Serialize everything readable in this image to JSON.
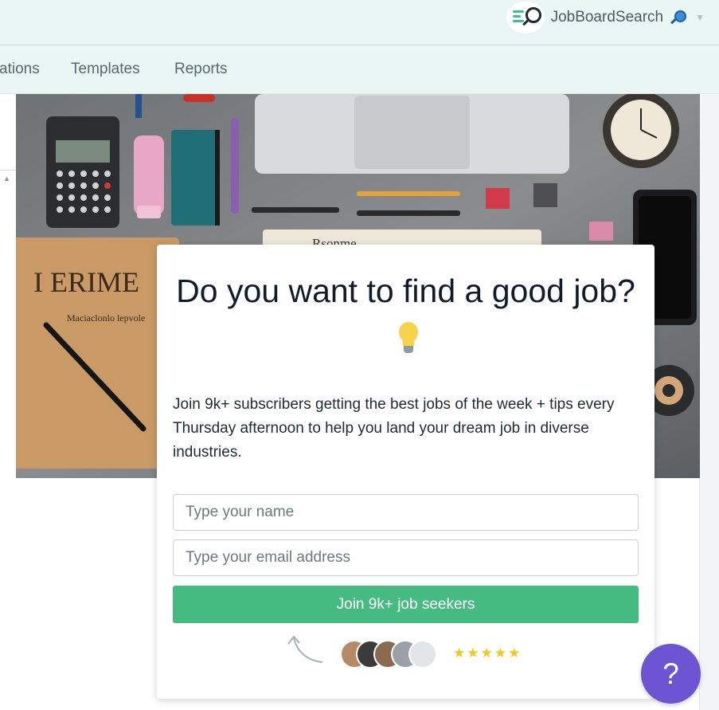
{
  "header": {
    "brand_name": "JobBoardSearch",
    "logo_icon": "magnifier-logo-icon",
    "brand_emoji_icon": "magnifying-glass-tilted-right-icon",
    "dropdown_icon": "caret-down-icon",
    "colors": {
      "bar_bg": "#e9f6f3",
      "bar_border": "#b9e0d6"
    }
  },
  "nav": {
    "items": [
      {
        "label": "ations"
      },
      {
        "label": "Templates"
      },
      {
        "label": "Reports"
      }
    ]
  },
  "hero": {
    "image": "flat-lay desk photo with notebook, calculator, laptop, clock, phone",
    "notebook_text": "I ERIME",
    "notebook_subtext": "Maciaclonlo lepvole",
    "note_text": "Rsonme"
  },
  "signup": {
    "headline": "Do you want to find a good job?",
    "headline_icon": "light-bulb-icon",
    "description": "Join 9k+ subscribers getting the best jobs of the week + tips every Thursday afternoon to help you land your dream job in diverse industries.",
    "name_placeholder": "Type your name",
    "email_placeholder": "Type your email address",
    "submit_label": "Join 9k+ job seekers",
    "rating": "★★★★★",
    "colors": {
      "button": "#45bb82",
      "stars": "#f5c518"
    }
  },
  "help": {
    "label": "?",
    "color": "#6b55d3"
  }
}
